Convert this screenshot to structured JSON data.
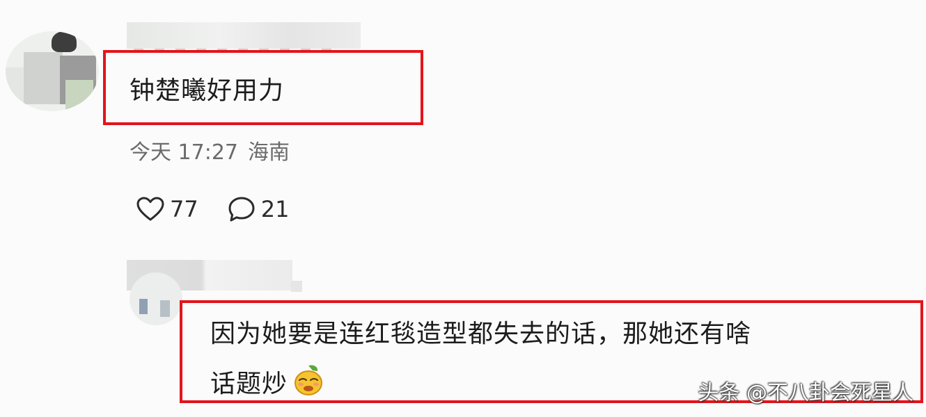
{
  "comment1": {
    "text": "钟楚曦好用力",
    "time": "今天 17:27",
    "location": "海南",
    "likes": "77",
    "replies": "21"
  },
  "comment2": {
    "line1": "因为她要是连红毯造型都失去的话，那她还有啥",
    "line2": "话题炒",
    "emoji": "speechless-face-emoji"
  },
  "watermark": "头条 @不八卦会死星人",
  "colors": {
    "highlight_border": "#e3141b",
    "meta_text": "#6b6b6b",
    "body_text": "#1c1c1c"
  }
}
